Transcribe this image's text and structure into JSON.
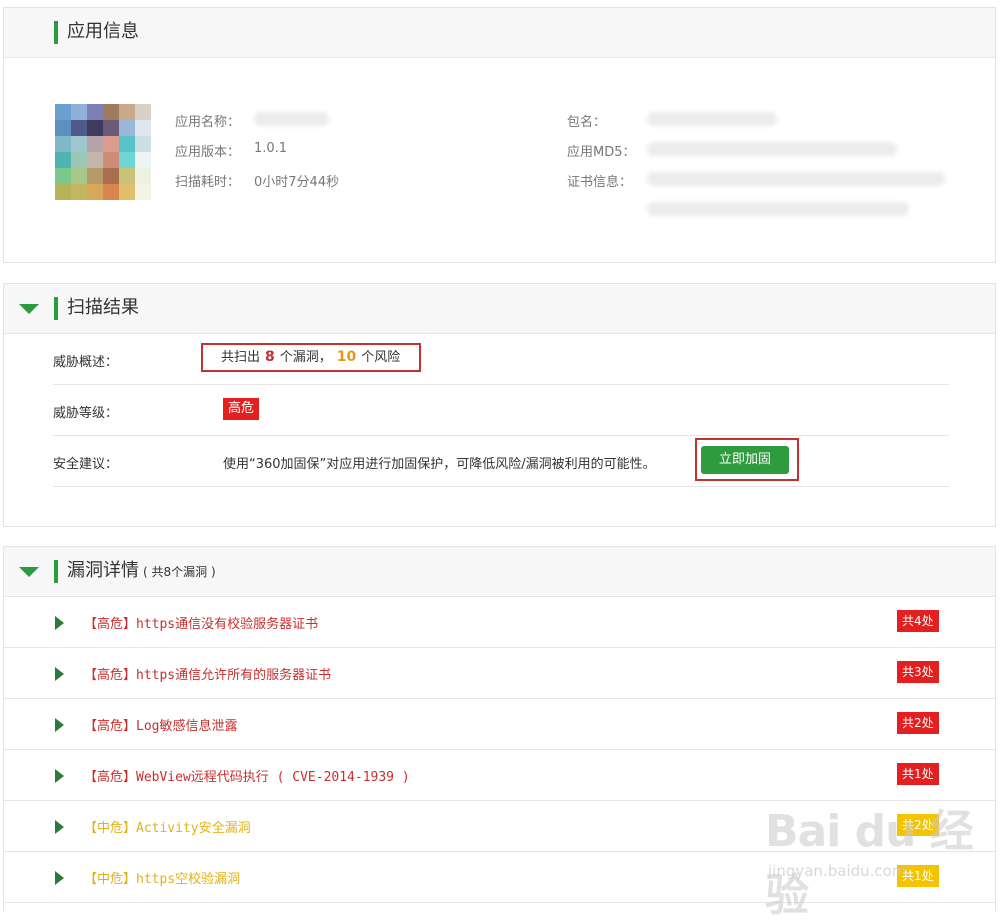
{
  "colors": {
    "accent": "#2c9a3e",
    "high": "#e41f1f",
    "medium": "#f5c400",
    "outline": "#c8302f"
  },
  "app_info": {
    "title": "应用信息",
    "name_label": "应用名称：",
    "version_label": "应用版本：",
    "version_value": "1.0.1",
    "scan_time_label": "扫描耗时：",
    "scan_time_value": "0小时7分44秒",
    "package_label": "包名：",
    "md5_label": "应用MD5：",
    "cert_label": "证书信息：",
    "icon": "app-icon-blurred"
  },
  "scan_results": {
    "title": "扫描结果",
    "threat_summary_label": "威胁概述：",
    "summary_prefix": "共扫出",
    "vuln_count": "8",
    "vuln_unit": "个漏洞，",
    "risk_count": "10",
    "risk_unit": "个风险",
    "threat_level_label": "威胁等级：",
    "threat_level": "高危",
    "advice_label": "安全建议：",
    "advice_text": "使用“360加固保”对应用进行加固保护，可降低风险/漏洞被利用的可能性。",
    "harden_button": "立即加固"
  },
  "vuln_details": {
    "title": "漏洞详情",
    "subtitle": "( 共8个漏洞 )",
    "items": [
      {
        "title": "【高危】https通信没有校验服务器证书",
        "count": "共4处",
        "level": "high"
      },
      {
        "title": "【高危】https通信允许所有的服务器证书",
        "count": "共3处",
        "level": "high"
      },
      {
        "title": "【高危】Log敏感信息泄露",
        "count": "共2处",
        "level": "high"
      },
      {
        "title": "【高危】WebView远程代码执行 ( CVE-2014-1939 )",
        "count": "共1处",
        "level": "high"
      },
      {
        "title": "【中危】Activity安全漏洞",
        "count": "共2处",
        "level": "medium"
      },
      {
        "title": "【中危】https空校验漏洞",
        "count": "共1处",
        "level": "medium"
      }
    ]
  },
  "watermark": {
    "brand": "Bai du 经验",
    "url": "jingyan.baidu.com"
  }
}
